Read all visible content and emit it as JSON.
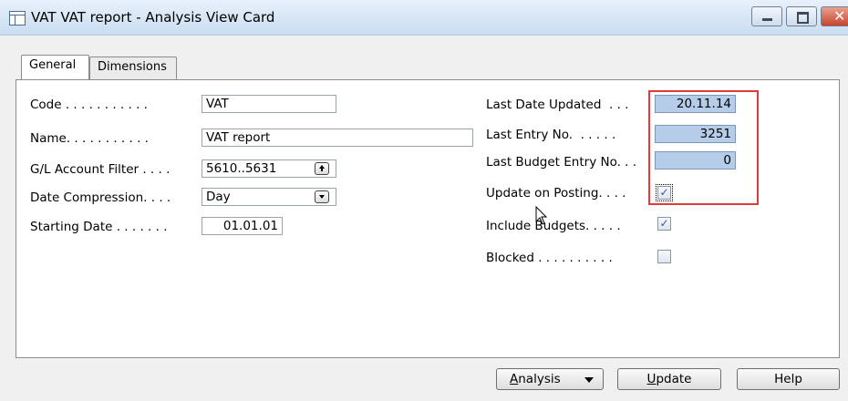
{
  "window": {
    "title": "VAT VAT report - Analysis View Card",
    "close_glyph": "✕"
  },
  "tabs": [
    {
      "label": "General",
      "active": true
    },
    {
      "label": "Dimensions",
      "active": false
    }
  ],
  "left_fields": {
    "code": {
      "label": "Code . . . . . . . . . . .",
      "value": "VAT"
    },
    "name": {
      "label": "Name. . . . . . . . . . .",
      "value": "VAT report"
    },
    "gl_account_filter": {
      "label": "G/L Account Filter . . . .",
      "value": "5610..5631"
    },
    "date_compression": {
      "label": "Date Compression. . . .",
      "value": "Day"
    },
    "starting_date": {
      "label": "Starting Date . . . . . . .",
      "value": "01.01.01"
    }
  },
  "right_fields": {
    "last_date_updated": {
      "label": "Last Date Updated  . . .",
      "value": "20.11.14"
    },
    "last_entry_no": {
      "label": "Last Entry No.  . . . . .",
      "value": "3251"
    },
    "last_budget_entry_no": {
      "label": "Last Budget Entry No. . .",
      "value": "0"
    },
    "update_on_posting": {
      "label": "Update on Posting. . . .",
      "checked": true
    },
    "include_budgets": {
      "label": "Include Budgets. . . . .",
      "checked": true
    },
    "blocked": {
      "label": "Blocked . . . . . . . . . .",
      "checked": false
    }
  },
  "buttons": {
    "analysis": {
      "underline": "A",
      "rest": "nalysis"
    },
    "update": {
      "underline": "U",
      "rest": "pdate"
    },
    "help": "Help"
  },
  "check_glyph": "✓",
  "colors": {
    "highlight": "#e03a3a",
    "readonly_field": "#b6cde9",
    "close_button": "#c8452c"
  }
}
